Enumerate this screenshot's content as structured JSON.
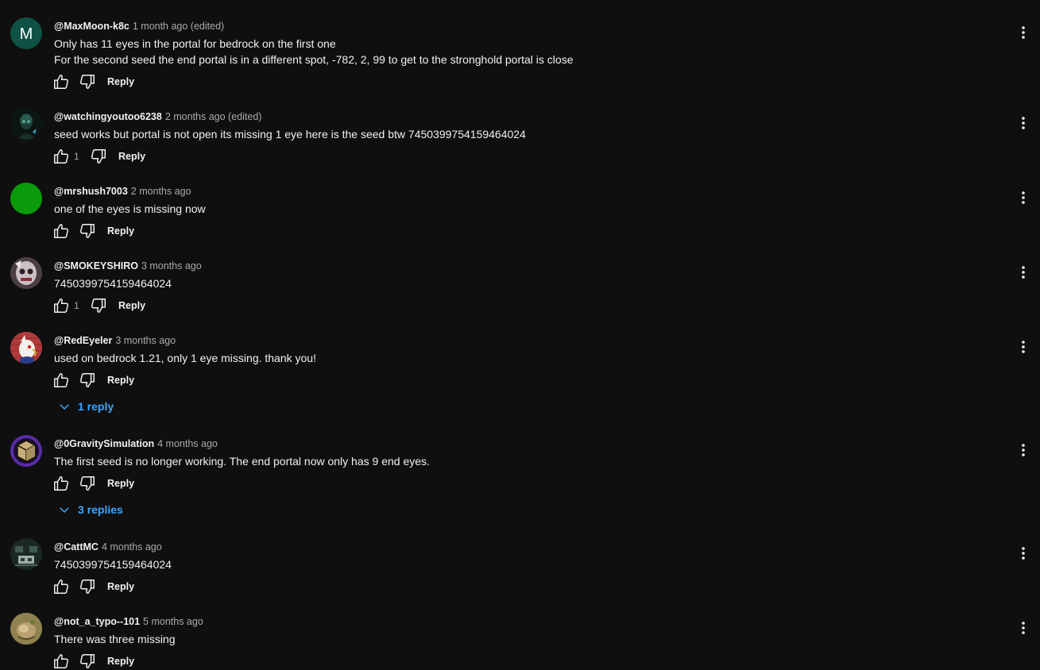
{
  "ui": {
    "reply_label": "Reply"
  },
  "comments": [
    {
      "author": "@MaxMoon-k8c",
      "time": "1 month ago (edited)",
      "text_lines": [
        "Only has 11 eyes in the portal for bedrock on the first one",
        "For the second seed the end portal is in a different spot, -782, 2, 99 to get to the stronghold portal is close"
      ],
      "likes": "",
      "avatar_letter": "M",
      "avatar_color": "#0d5245"
    },
    {
      "author": "@watchingyoutoo6238",
      "time": "2 months ago (edited)",
      "text_lines": [
        "seed works but portal is not open its missing 1 eye here is the seed btw 7450399754159464024"
      ],
      "likes": "1"
    },
    {
      "author": "@mrshush7003",
      "time": "2 months ago",
      "text_lines": [
        "one of the eyes is missing now"
      ],
      "likes": "",
      "avatar_color": "#0a9a0a"
    },
    {
      "author": "@SMOKEYSHIRO",
      "time": "3 months ago",
      "text_lines": [
        "7450399754159464024"
      ],
      "likes": "1"
    },
    {
      "author": "@RedEyeler",
      "time": "3 months ago",
      "text_lines": [
        "used on bedrock 1.21, only 1 eye missing. thank you!"
      ],
      "likes": "",
      "replies": "1 reply"
    },
    {
      "author": "@0GravitySimulation",
      "time": "4 months ago",
      "text_lines": [
        "The first seed is no longer working. The end portal now only has 9 end eyes."
      ],
      "likes": "",
      "replies": "3 replies"
    },
    {
      "author": "@CattMC",
      "time": "4 months ago",
      "text_lines": [
        "7450399754159464024"
      ],
      "likes": ""
    },
    {
      "author": "@not_a_typo--101",
      "time": "5 months ago",
      "text_lines": [
        "There was three missing"
      ],
      "likes": ""
    }
  ],
  "colors": {
    "background": "#0f0f0f",
    "text": "#f1f1f1",
    "secondary_text": "#aaaaaa",
    "link_blue": "#3ea6ff"
  }
}
